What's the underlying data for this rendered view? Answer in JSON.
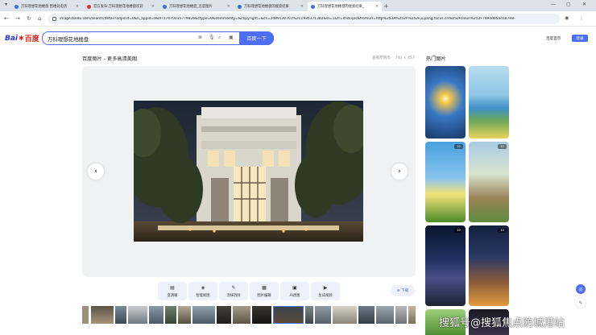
{
  "browser": {
    "tabs": [
      {
        "label": "万科理想花地楼盘 售楼处电话"
      },
      {
        "label": "官方发布:万科理想花地楼盘欢迎"
      },
      {
        "label": "万科理想花地楼盘_百度图片"
      },
      {
        "label": "万科理想花地楼盘的搜索结果"
      },
      {
        "label": "万科理想花地楼盘的搜索结果_"
      }
    ],
    "url": "image.baidu.com/search/detail?adpicid=0&n_appid=0&9717470015779826&ctype=0&commodity=&copyright=&cs=2489130701%2C1935371382&di=1&fr=click-pic&fromurl=http%253A%252F%252Fjiujiang.focus.cn%252Fzixun%252F7494d05ad187e8-",
    "accent": "#4e6ef2"
  },
  "header": {
    "logo": {
      "bai": "Bai",
      "du": "百度"
    },
    "search_value": "万科理想花地楼盘",
    "search_button": "百度一下",
    "home_link": "百度首页",
    "login_button": "登录"
  },
  "viewer": {
    "breadcrumb": "百度图片 - 更多高清美图",
    "source_label": "查看原网页",
    "dimensions": "740 × 457"
  },
  "tools": [
    {
      "label": "变清晰",
      "icon": "enhance-icon"
    },
    {
      "label": "智能抠图",
      "icon": "cutout-icon"
    },
    {
      "label": "涂抹消除",
      "icon": "eraser-icon"
    },
    {
      "label": "图片编辑",
      "icon": "edit-icon"
    },
    {
      "label": "AI改图",
      "icon": "ai-edit-icon"
    },
    {
      "label": "生成视频",
      "icon": "video-icon"
    }
  ],
  "download_label": "下载",
  "hot": {
    "title": "热门图片",
    "badge": "10"
  },
  "watermark": "搜狐号@搜狐焦点防城港站"
}
